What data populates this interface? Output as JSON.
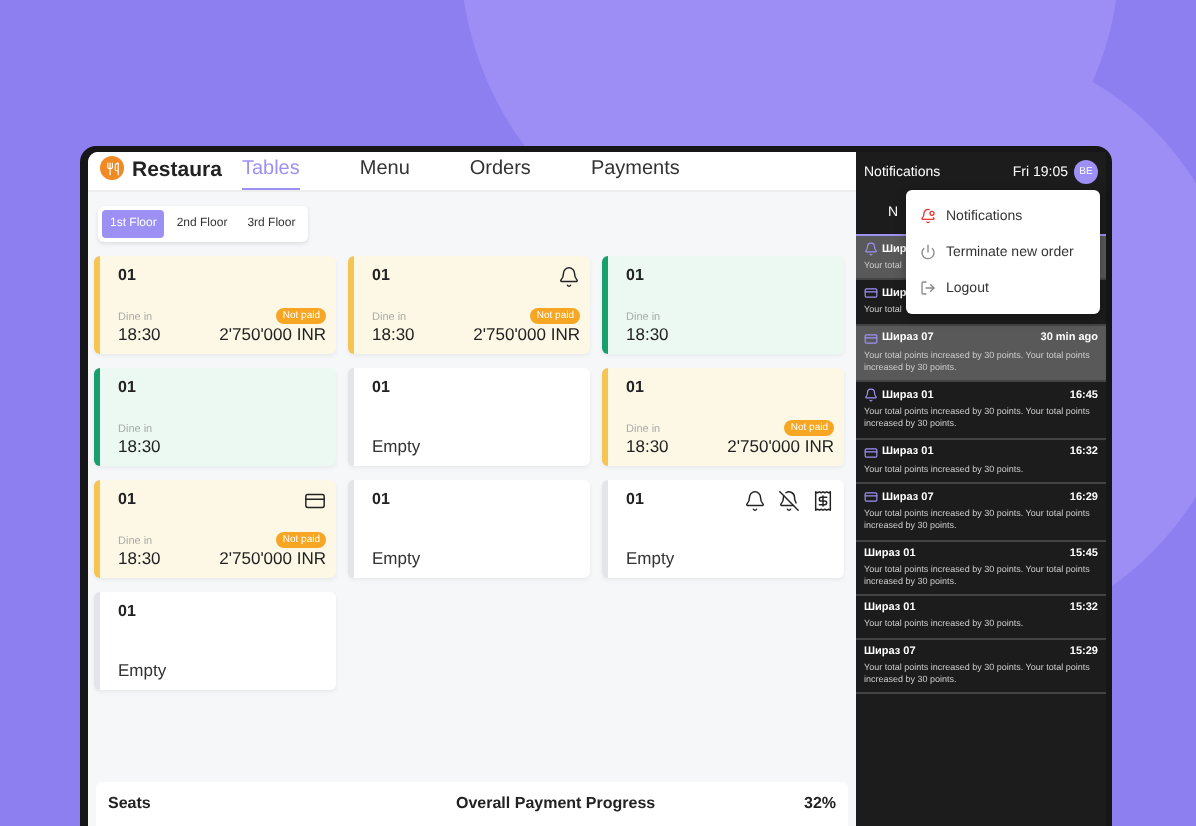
{
  "app": {
    "brand": "Restaura",
    "tabs": [
      {
        "label": "Tables",
        "selected": true
      },
      {
        "label": "Menu",
        "selected": false
      },
      {
        "label": "Orders",
        "selected": false
      },
      {
        "label": "Payments",
        "selected": false
      }
    ]
  },
  "floors": [
    {
      "label": "1st Floor",
      "selected": true
    },
    {
      "label": "2nd Floor",
      "selected": false
    },
    {
      "label": "3rd Floor",
      "selected": false
    }
  ],
  "tables": [
    {
      "kind": "unpaid",
      "number": "01",
      "service": "Dine in",
      "time": "18:30",
      "badge": "Not paid",
      "amount": "2'750'000 INR"
    },
    {
      "kind": "unpaid",
      "number": "01",
      "service": "Dine in",
      "time": "18:30",
      "badge": "Not paid",
      "amount": "2'750'000 INR"
    },
    {
      "kind": "paid",
      "number": "01",
      "service": "Dine in",
      "time": "18:30"
    },
    {
      "kind": "paid",
      "number": "01",
      "service": "Dine in",
      "time": "18:30"
    },
    {
      "kind": "empty",
      "number": "01",
      "status": "Empty"
    },
    {
      "kind": "unpaid",
      "number": "01",
      "service": "Dine in",
      "time": "18:30",
      "badge": "Not paid",
      "amount": "2'750'000 INR"
    },
    {
      "kind": "unpaid",
      "number": "01",
      "service": "Dine in",
      "time": "18:30",
      "badge": "Not paid",
      "amount": "2'750'000 INR"
    },
    {
      "kind": "empty",
      "number": "01",
      "status": "Empty"
    },
    {
      "kind": "empty",
      "number": "01",
      "status": "Empty"
    },
    {
      "kind": "empty",
      "number": "01",
      "status": "Empty"
    }
  ],
  "summary": {
    "seats": "Seats",
    "progress_label": "Overall Payment Progress",
    "progress_value": "32%"
  },
  "notifications": {
    "title": "Notifications",
    "clock": "Fri 19:05",
    "avatar": "BE",
    "tab": "N",
    "items": [
      {
        "title": "Шир",
        "text": "Your total",
        "selected": true
      },
      {
        "title": "Шир",
        "text": "Your total",
        "selected": false
      },
      {
        "title": "Шираз 07",
        "time": "30 min ago",
        "text": "Your total points increased by 30 points. Your total points increased by 30 points.",
        "selected": true
      },
      {
        "title": "Шираз 01",
        "time": "16:45",
        "text": "Your total points increased by 30 points. Your total points increased by 30 points.",
        "selected": false
      },
      {
        "title": "Шираз 01",
        "time": "16:32",
        "text": "Your total points increased by 30 points.",
        "selected": false
      },
      {
        "title": "Шираз 07",
        "time": "16:29",
        "text": "Your total points increased by 30 points. Your total points increased by 30 points.",
        "selected": false
      },
      {
        "title": "Шираз 01",
        "time": "15:45",
        "text": "Your total points increased by 30 points. Your total points increased by 30 points.",
        "selected": false
      },
      {
        "title": "Шираз 01",
        "time": "15:32",
        "text": "Your total points increased by 30 points.",
        "selected": false
      },
      {
        "title": "Шираз 07",
        "time": "15:29",
        "text": "Your total points increased by 30 points. Your total points increased by 30 points.",
        "selected": false
      }
    ]
  },
  "menu": [
    {
      "label": "Notifications"
    },
    {
      "label": "Terminate new order"
    },
    {
      "label": "Logout"
    }
  ]
}
